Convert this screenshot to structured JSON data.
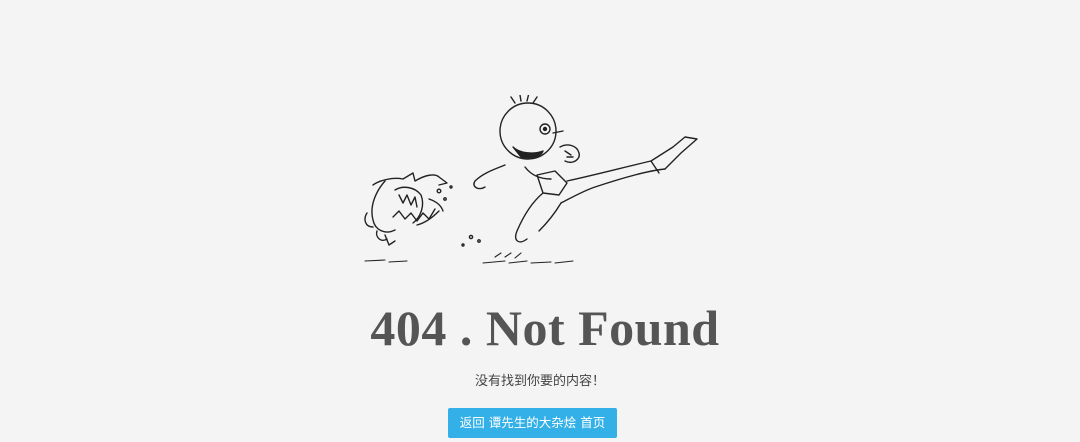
{
  "error": {
    "title": "404 . Not Found",
    "message": "没有找到你要的内容！"
  },
  "home_button": {
    "prefix": "返回",
    "site_name": "谭先生的大杂烩",
    "suffix": "首页"
  },
  "illustration": {
    "icon": "shark-chasing-man-sketch"
  },
  "colors": {
    "background": "#f4f4f4",
    "text": "#555555",
    "button": "#33b0e8",
    "button_text": "#ffffff"
  }
}
